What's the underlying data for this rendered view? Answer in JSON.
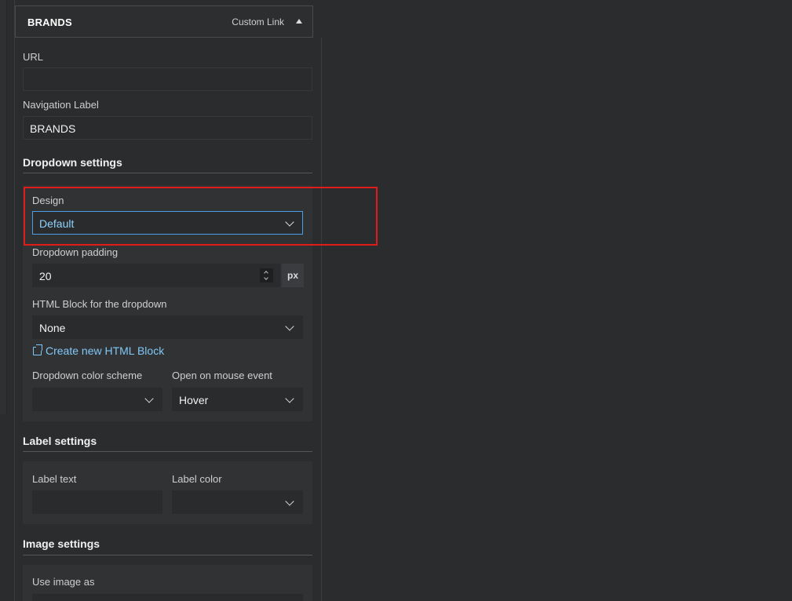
{
  "menu_item": {
    "title": "BRANDS",
    "type_label": "Custom Link"
  },
  "fields": {
    "url_label": "URL",
    "url_value": "",
    "nav_label_label": "Navigation Label",
    "nav_label_value": "BRANDS"
  },
  "dropdown_settings": {
    "section_title": "Dropdown settings",
    "design_label": "Design",
    "design_value": "Default",
    "padding_label": "Dropdown padding",
    "padding_value": "20",
    "padding_unit": "px",
    "html_block_label": "HTML Block for the dropdown",
    "html_block_value": "None",
    "create_link": "Create new HTML Block",
    "color_scheme_label": "Dropdown color scheme",
    "color_scheme_value": "",
    "mouse_event_label": "Open on mouse event",
    "mouse_event_value": "Hover"
  },
  "label_settings": {
    "section_title": "Label settings",
    "label_text_label": "Label text",
    "label_text_value": "",
    "label_color_label": "Label color",
    "label_color_value": ""
  },
  "image_settings": {
    "section_title": "Image settings",
    "use_image_label": "Use image as"
  },
  "colors": {
    "accent_link": "#7fc8f8",
    "focus_border": "#4a9fe8",
    "highlight": "#e21b1b"
  }
}
